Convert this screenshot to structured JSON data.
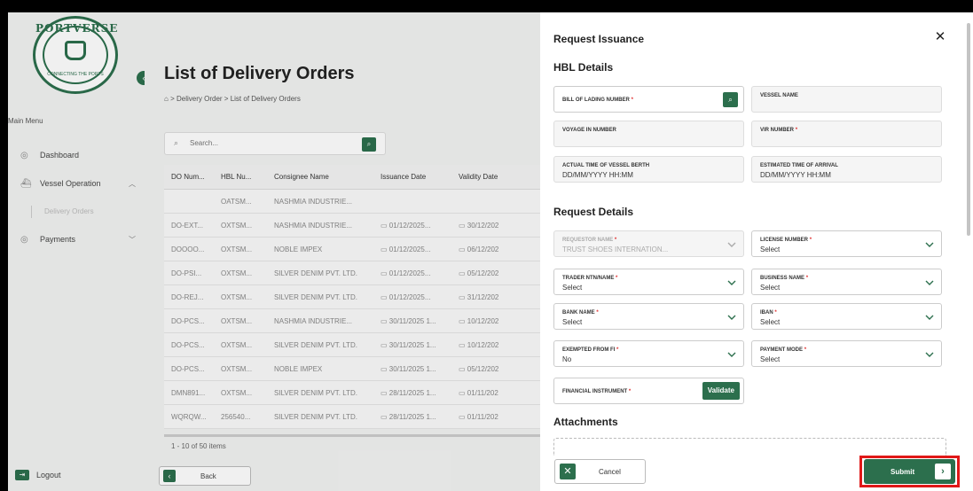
{
  "sidebar": {
    "logo_text": "PORTVERSE",
    "logo_subtext": "CONNECTING THE PORTS",
    "menu_heading": "Main Menu",
    "items": [
      {
        "label": "Dashboard",
        "icon": "dashboard-icon"
      },
      {
        "label": "Vessel Operation",
        "icon": "ship-icon"
      },
      {
        "label": "Payments",
        "icon": "payments-icon"
      }
    ],
    "sub_item": "Delivery Orders",
    "logout": "Logout"
  },
  "main": {
    "title": "List of Delivery Orders",
    "breadcrumb": [
      "Delivery Order",
      "List of Delivery Orders"
    ],
    "search_placeholder": "Search...",
    "columns": [
      "DO Num...",
      "HBL Nu...",
      "Consignee Name",
      "Issuance Date",
      "Validity Date"
    ],
    "rows": [
      [
        "",
        "OATSM...",
        "NASHMIA INDUSTRIE...",
        "",
        ""
      ],
      [
        "DO-EXT...",
        "OXTSM...",
        "NASHMIA INDUSTRIE...",
        "01/12/2025...",
        "30/12/202"
      ],
      [
        "DOOOO...",
        "OXTSM...",
        "NOBLE IMPEX",
        "01/12/2025...",
        "06/12/202"
      ],
      [
        "DO-PSI...",
        "OXTSM...",
        "SILVER DENIM PVT. LTD.",
        "01/12/2025...",
        "05/12/202"
      ],
      [
        "DO-REJ...",
        "OXTSM...",
        "SILVER DENIM PVT. LTD.",
        "01/12/2025...",
        "31/12/202"
      ],
      [
        "DO-PCS...",
        "OXTSM...",
        "NASHMIA INDUSTRIE...",
        "30/11/2025 1...",
        "10/12/202"
      ],
      [
        "DO-PCS...",
        "OXTSM...",
        "SILVER DENIM PVT. LTD.",
        "30/11/2025 1...",
        "10/12/202"
      ],
      [
        "DO-PCS...",
        "OXTSM...",
        "NOBLE IMPEX",
        "30/11/2025 1...",
        "05/12/202"
      ],
      [
        "DMN891...",
        "OXTSM...",
        "SILVER DENIM PVT. LTD.",
        "28/11/2025 1...",
        "01/11/202"
      ],
      [
        "WQRQW...",
        "256540...",
        "SILVER DENIM PVT. LTD.",
        "28/11/2025 1...",
        "01/11/202"
      ]
    ],
    "footer": "1 - 10 of 50 items",
    "back": "Back"
  },
  "drawer": {
    "title": "Request Issuance",
    "hbl_title": "HBL Details",
    "bill_of_lading": "BILL OF LADING NUMBER",
    "vessel_name": "VESSEL NAME",
    "voyage_in": "VOYAGE IN NUMBER",
    "vir_number": "VIR NUMBER",
    "actual_time": "ACTUAL TIME OF VESSEL BERTH",
    "actual_time_val": "DD/MM/YYYY HH:MM",
    "eta": "ESTIMATED TIME OF ARRIVAL",
    "eta_val": "DD/MM/YYYY HH:MM",
    "request_title": "Request Details",
    "requestor": "REQUESTOR NAME",
    "requestor_val": "TRUST SHOES INTERNATION...",
    "license": "LICENSE NUMBER",
    "trader": "TRADER NTN/NAME",
    "business": "BUSINESS NAME",
    "bank": "BANK NAME",
    "iban": "IBAN",
    "exempted": "EXEMPTED FROM FI",
    "exempted_val": "No",
    "payment_mode": "PAYMENT MODE",
    "select": "Select",
    "fin_instrument": "FINANCIAL INSTRUMENT",
    "validate": "Validate",
    "attachments_title": "Attachments",
    "cancel": "Cancel",
    "submit": "Submit",
    "req_mark": "*"
  },
  "colors": {
    "brand": "#2c6f4d",
    "highlight": "#e01818"
  }
}
